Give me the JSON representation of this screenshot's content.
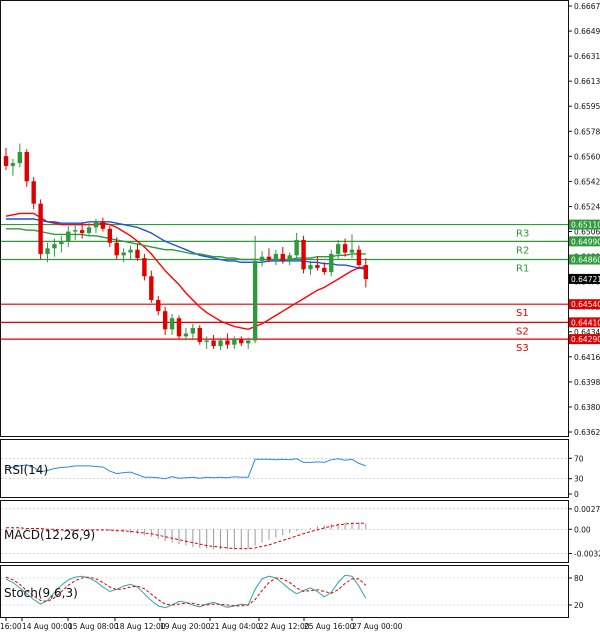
{
  "chart_data": [
    {
      "type": "candlestick",
      "panel": "price",
      "ylim": [
        0.63625,
        0.66675
      ],
      "y_ticks": [
        "0.66675",
        "0.66495",
        "0.66315",
        "0.66135",
        "0.65955",
        "0.65780",
        "0.65600",
        "0.65420",
        "0.65240",
        "0.65060",
        "0.64880",
        "0.64700",
        "0.64520",
        "0.64340",
        "0.64160",
        "0.63980",
        "0.63800",
        "0.63625"
      ],
      "x_ticks": [
        "16:00",
        "14 Aug 00:00",
        "15 Aug 08:00",
        "18 Aug 12:00",
        "19 Aug 20:00",
        "21 Aug 04:00",
        "22 Aug 12:00",
        "25 Aug 16:00",
        "27 Aug 00:00"
      ],
      "candles": [
        [
          0.656,
          0.6566,
          0.655,
          0.6553
        ],
        [
          0.6553,
          0.6558,
          0.6546,
          0.6555
        ],
        [
          0.6555,
          0.6569,
          0.6552,
          0.6563
        ],
        [
          0.6563,
          0.6565,
          0.6538,
          0.6542
        ],
        [
          0.6542,
          0.6545,
          0.6522,
          0.6526
        ],
        [
          0.6526,
          0.6529,
          0.6486,
          0.649
        ],
        [
          0.649,
          0.6498,
          0.6484,
          0.6494
        ],
        [
          0.6494,
          0.6501,
          0.6488,
          0.6497
        ],
        [
          0.6497,
          0.6503,
          0.6491,
          0.6499
        ],
        [
          0.6499,
          0.651,
          0.6495,
          0.6506
        ],
        [
          0.6506,
          0.6511,
          0.65,
          0.6507
        ],
        [
          0.6507,
          0.6513,
          0.6501,
          0.6505
        ],
        [
          0.6505,
          0.6512,
          0.6503,
          0.6509
        ],
        [
          0.6509,
          0.6515,
          0.6505,
          0.6513
        ],
        [
          0.6513,
          0.6516,
          0.6506,
          0.6508
        ],
        [
          0.6508,
          0.651,
          0.6495,
          0.6498
        ],
        [
          0.6498,
          0.6502,
          0.6486,
          0.6489
        ],
        [
          0.6489,
          0.6494,
          0.6484,
          0.6491
        ],
        [
          0.6491,
          0.6496,
          0.6486,
          0.6493
        ],
        [
          0.6493,
          0.6497,
          0.6485,
          0.6487
        ],
        [
          0.6487,
          0.649,
          0.6471,
          0.6474
        ],
        [
          0.6474,
          0.6478,
          0.6455,
          0.6457
        ],
        [
          0.6457,
          0.646,
          0.6446,
          0.6449
        ],
        [
          0.6449,
          0.6452,
          0.6432,
          0.6436
        ],
        [
          0.6436,
          0.6447,
          0.6432,
          0.6444
        ],
        [
          0.6444,
          0.6446,
          0.6429,
          0.6431
        ],
        [
          0.6431,
          0.6437,
          0.6428,
          0.6433
        ],
        [
          0.6433,
          0.644,
          0.6429,
          0.6437
        ],
        [
          0.6437,
          0.6439,
          0.6425,
          0.6427
        ],
        [
          0.6427,
          0.6431,
          0.6422,
          0.6428
        ],
        [
          0.6428,
          0.6432,
          0.6422,
          0.6424
        ],
        [
          0.6424,
          0.643,
          0.6421,
          0.6428
        ],
        [
          0.6428,
          0.6433,
          0.6422,
          0.6425
        ],
        [
          0.6425,
          0.6431,
          0.6422,
          0.6429
        ],
        [
          0.6429,
          0.6431,
          0.6424,
          0.6426
        ],
        [
          0.6426,
          0.643,
          0.6422,
          0.6428
        ],
        [
          0.6428,
          0.6503,
          0.6426,
          0.6485
        ],
        [
          0.6485,
          0.6492,
          0.6481,
          0.6488
        ],
        [
          0.6488,
          0.6494,
          0.6484,
          0.6486
        ],
        [
          0.6486,
          0.6493,
          0.6482,
          0.649
        ],
        [
          0.649,
          0.6495,
          0.6483,
          0.6485
        ],
        [
          0.6485,
          0.6491,
          0.6482,
          0.6489
        ],
        [
          0.6489,
          0.6505,
          0.6486,
          0.65
        ],
        [
          0.65,
          0.6503,
          0.6476,
          0.6479
        ],
        [
          0.6479,
          0.6485,
          0.6475,
          0.6482
        ],
        [
          0.6482,
          0.6488,
          0.6478,
          0.648
        ],
        [
          0.648,
          0.6484,
          0.6475,
          0.6477
        ],
        [
          0.6477,
          0.6493,
          0.6474,
          0.649
        ],
        [
          0.649,
          0.65,
          0.6486,
          0.6497
        ],
        [
          0.6497,
          0.6501,
          0.6488,
          0.6491
        ],
        [
          0.6491,
          0.6504,
          0.6487,
          0.6493
        ],
        [
          0.6493,
          0.6496,
          0.6479,
          0.6482
        ],
        [
          0.6482,
          0.6487,
          0.6466,
          0.6472
        ]
      ],
      "series": [
        {
          "name": "",
          "color": "#ff0000",
          "values": [
            0.6517,
            0.6518,
            0.6519,
            0.6519,
            0.6519,
            0.6516,
            0.6513,
            0.6512,
            0.6511,
            0.6511,
            0.6511,
            0.6511,
            0.6511,
            0.6511,
            0.6512,
            0.6511,
            0.6509,
            0.6506,
            0.6503,
            0.6499,
            0.6495,
            0.649,
            0.6484,
            0.6478,
            0.6473,
            0.6468,
            0.6462,
            0.6457,
            0.6452,
            0.6448,
            0.6445,
            0.6442,
            0.644,
            0.6438,
            0.6437,
            0.6436,
            0.6438,
            0.644,
            0.6443,
            0.6446,
            0.6449,
            0.6452,
            0.6455,
            0.6458,
            0.6461,
            0.6464,
            0.6466,
            0.6469,
            0.6472,
            0.6475,
            0.6478,
            0.648,
            0.6481
          ]
        },
        {
          "name": "",
          "color": "#1e50dc",
          "values": [
            0.6515,
            0.6515,
            0.6515,
            0.6515,
            0.6515,
            0.6514,
            0.6513,
            0.6513,
            0.6512,
            0.6512,
            0.6512,
            0.6512,
            0.6513,
            0.6513,
            0.6513,
            0.6513,
            0.6512,
            0.6511,
            0.651,
            0.6509,
            0.6507,
            0.6505,
            0.6502,
            0.6499,
            0.6497,
            0.6495,
            0.6493,
            0.6491,
            0.6489,
            0.6488,
            0.6487,
            0.6486,
            0.6485,
            0.6485,
            0.6484,
            0.6484,
            0.6484,
            0.6484,
            0.6485,
            0.6485,
            0.6485,
            0.6485,
            0.6485,
            0.6485,
            0.6484,
            0.6484,
            0.6483,
            0.6483,
            0.6482,
            0.6482,
            0.6481,
            0.648,
            0.6479
          ]
        },
        {
          "name": "",
          "color": "#2e9a3c",
          "values": [
            0.6508,
            0.6508,
            0.6508,
            0.6507,
            0.6507,
            0.6506,
            0.6505,
            0.6504,
            0.6504,
            0.6504,
            0.6504,
            0.6504,
            0.6503,
            0.6503,
            0.6502,
            0.6501,
            0.65,
            0.6499,
            0.6498,
            0.6497,
            0.6496,
            0.6495,
            0.6494,
            0.6493,
            0.6493,
            0.6492,
            0.6491,
            0.649,
            0.649,
            0.6489,
            0.6488,
            0.6488,
            0.6487,
            0.6487,
            0.6486,
            0.6486,
            0.6486,
            0.6486,
            0.6486,
            0.6486,
            0.6486,
            0.6486,
            0.6487,
            0.6487,
            0.6487,
            0.6488,
            0.6488,
            0.6488,
            0.6489,
            0.6489,
            0.649,
            0.649,
            0.649
          ]
        }
      ],
      "levels": [
        {
          "label": "R3",
          "value": "0.65110",
          "color": "#2e9a3c"
        },
        {
          "label": "R2",
          "value": "0.64990",
          "color": "#2e9a3c"
        },
        {
          "label": "R1",
          "value": "0.64860",
          "color": "#2e9a3c"
        },
        {
          "label": "S1",
          "value": "0.64540",
          "color": "#e00000"
        },
        {
          "label": "S2",
          "value": "0.64410",
          "color": "#e00000"
        },
        {
          "label": "S3",
          "value": "0.64290",
          "color": "#e00000"
        }
      ],
      "current_price": "0.64721",
      "colors": {
        "up": "#2e9a3c",
        "down": "#e00000"
      }
    },
    {
      "type": "line",
      "panel": "rsi",
      "title": "RSI(14)",
      "ylim": [
        0,
        100
      ],
      "y_ticks": [
        {
          "label": "70",
          "value": 70
        },
        {
          "label": "30",
          "value": 30
        },
        {
          "label": "0",
          "value": 0
        }
      ],
      "series": [
        {
          "name": "",
          "color": "#2e8be0",
          "values": [
            52,
            52,
            55,
            57,
            52,
            44,
            46,
            50,
            52,
            53,
            55,
            55,
            55,
            54,
            53,
            45,
            40,
            42,
            43,
            38,
            33,
            33,
            32,
            30,
            34,
            31,
            32,
            33,
            31,
            33,
            32,
            33,
            32,
            34,
            33,
            33,
            68,
            68,
            68,
            67,
            68,
            67,
            69,
            62,
            62,
            63,
            62,
            67,
            69,
            66,
            68,
            60,
            55
          ]
        }
      ]
    },
    {
      "type": "bar",
      "panel": "macd",
      "title": "MACD(12,26,9)",
      "ylim": [
        -0.004,
        0.0034
      ],
      "y_ticks": [
        {
          "label": "0.002748",
          "value": 0.002748
        },
        {
          "label": "0.00",
          "value": 0
        },
        {
          "label": "-0.003263",
          "value": -0.003263
        }
      ],
      "histogram": [
        0.0001,
        0.0001,
        0.0001,
        0.0001,
        5e-05,
        0.0,
        -0.0001,
        -0.0001,
        -0.0001,
        -0.0001,
        -0.0001,
        -0.0001,
        -0.0001,
        -0.0001,
        -0.0001,
        -0.0002,
        -0.0003,
        -0.0004,
        -0.0005,
        -0.0006,
        -0.0008,
        -0.001,
        -0.0013,
        -0.0016,
        -0.0018,
        -0.002,
        -0.0022,
        -0.0024,
        -0.0025,
        -0.0026,
        -0.0027,
        -0.0027,
        -0.0027,
        -0.0027,
        -0.0027,
        -0.0026,
        -0.0022,
        -0.0018,
        -0.0014,
        -0.0011,
        -0.0008,
        -0.0005,
        -0.0002,
        0.0,
        0.0002,
        0.0004,
        0.0005,
        0.0007,
        0.0008,
        0.0009,
        0.0009,
        0.0009,
        0.0008
      ],
      "series": [
        {
          "name": "",
          "color": "#e00000",
          "values": [
            0.0002,
            0.0002,
            0.0002,
            0.0001,
            0.0001,
            0.0001,
            0.0,
            0.0,
            -0.0001,
            -0.0001,
            -0.0001,
            -0.0001,
            -0.0001,
            -0.0001,
            -0.0001,
            -0.0001,
            -0.0002,
            -0.0002,
            -0.0003,
            -0.0004,
            -0.0005,
            -0.0006,
            -0.0008,
            -0.001,
            -0.0012,
            -0.0014,
            -0.0016,
            -0.0018,
            -0.002,
            -0.0022,
            -0.0023,
            -0.0024,
            -0.0025,
            -0.0026,
            -0.0026,
            -0.0026,
            -0.0025,
            -0.0023,
            -0.0021,
            -0.0018,
            -0.0015,
            -0.0012,
            -0.0009,
            -0.0006,
            -0.0003,
            -0.0001,
            0.0002,
            0.0004,
            0.0006,
            0.0007,
            0.0008,
            0.0008,
            0.0008
          ]
        }
      ]
    },
    {
      "type": "line",
      "panel": "stochastic",
      "title": "Stoch(9,6,3)",
      "ylim": [
        0,
        100
      ],
      "y_ticks": [
        {
          "label": "80",
          "value": 80
        },
        {
          "label": "20",
          "value": 20
        }
      ],
      "series": [
        {
          "name": "",
          "color": "#2aa8a8",
          "values": [
            78,
            70,
            58,
            45,
            32,
            22,
            30,
            48,
            64,
            76,
            82,
            84,
            80,
            72,
            60,
            50,
            55,
            62,
            66,
            60,
            45,
            30,
            18,
            14,
            20,
            28,
            26,
            20,
            16,
            22,
            26,
            20,
            15,
            18,
            22,
            20,
            55,
            78,
            84,
            80,
            68,
            55,
            45,
            52,
            58,
            50,
            38,
            48,
            70,
            86,
            84,
            62,
            35
          ]
        },
        {
          "name": "",
          "color": "#e00000",
          "values": [
            82,
            76,
            66,
            52,
            40,
            30,
            28,
            36,
            50,
            64,
            74,
            80,
            82,
            78,
            70,
            60,
            54,
            56,
            60,
            62,
            56,
            44,
            32,
            22,
            20,
            22,
            24,
            24,
            20,
            20,
            22,
            22,
            20,
            18,
            18,
            20,
            32,
            52,
            70,
            80,
            78,
            70,
            58,
            50,
            52,
            54,
            50,
            46,
            54,
            68,
            78,
            78,
            64
          ]
        }
      ]
    }
  ]
}
